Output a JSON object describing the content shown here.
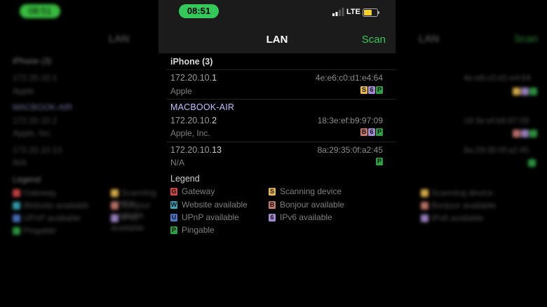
{
  "status": {
    "time": "08:51",
    "network": "LTE"
  },
  "nav": {
    "title": "LAN",
    "scan": "Scan"
  },
  "groups": [
    {
      "title": "iPhone (3)",
      "devices": [
        {
          "ip_prefix": "172.20.10.",
          "ip_suffix": "1",
          "mac": "4e:e6:c0:d1:e4:64",
          "vendor": "Apple",
          "badges": [
            "S",
            "6",
            "P"
          ]
        }
      ]
    },
    {
      "title": "MACBOOK-AIR",
      "devices": [
        {
          "ip_prefix": "172.20.10.",
          "ip_suffix": "2",
          "mac": "18:3e:ef:b9:97:09",
          "vendor": "Apple, Inc.",
          "badges": [
            "B",
            "6",
            "P"
          ]
        },
        {
          "ip_prefix": "172.20.10.",
          "ip_suffix": "13",
          "mac": "8a:29:35:0f:a2:45",
          "vendor": "N/A",
          "badges": [
            "P"
          ]
        }
      ]
    }
  ],
  "legend": {
    "title": "Legend",
    "items": [
      {
        "badge": "G",
        "label": "Gateway"
      },
      {
        "badge": "S",
        "label": "Scanning device"
      },
      {
        "badge": "W",
        "label": "Website available"
      },
      {
        "badge": "B",
        "label": "Bonjour available"
      },
      {
        "badge": "U",
        "label": "UPnP available"
      },
      {
        "badge": "6",
        "label": "IPv6 available"
      },
      {
        "badge": "P",
        "label": "Pingable"
      }
    ]
  },
  "colors": {
    "accent": "#34c759",
    "background": "#000000",
    "header": "#1b1b1b"
  }
}
